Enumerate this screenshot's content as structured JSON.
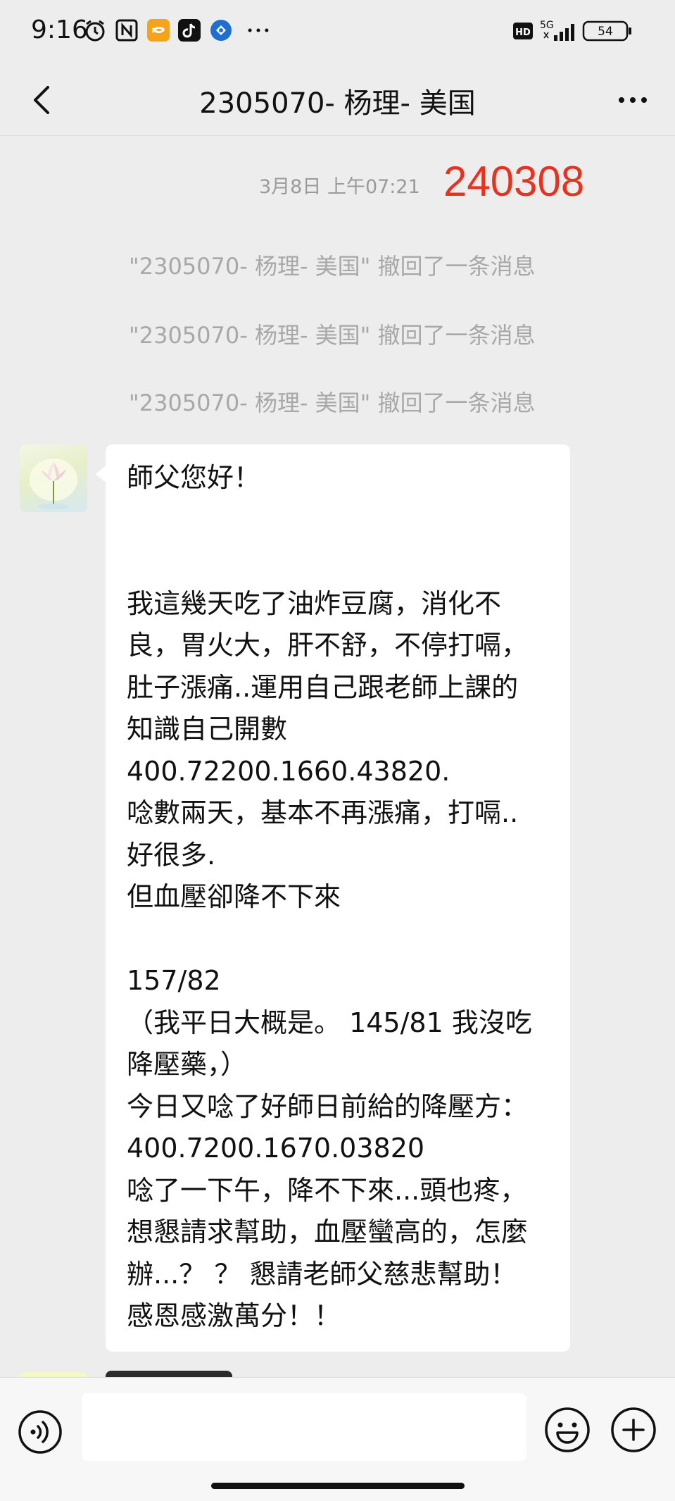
{
  "status_bar": {
    "time": "9:16",
    "icons": [
      "alarm-icon",
      "nfc-icon",
      "app-icon-orange",
      "tiktok-icon",
      "app-icon-blue",
      "more-dots-icon"
    ],
    "network": "5G",
    "hd": "HD",
    "battery": "54"
  },
  "header": {
    "title": "2305070- 杨理- 美国",
    "back_icon": "chevron-left-icon",
    "more_icon": "more-horizontal-icon"
  },
  "chat": {
    "timestamp": "3月8日 上午07:21",
    "annotation": "240308",
    "system_messages": [
      "\"2305070- 杨理- 美国\" 撤回了一条消息",
      "\"2305070- 杨理- 美国\" 撤回了一条消息",
      "\"2305070- 杨理- 美国\" 撤回了一条消息"
    ],
    "message": {
      "lines": [
        "師父您好！",
        "",
        "",
        "我這幾天吃了油炸豆腐，消化不",
        "良，胃火大，肝不舒，不停打嗝，",
        "肚子漲痛..運用自己跟老師上課的",
        "知識自己開數",
        "400.72200.1660.43820.",
        "唸數兩天，基本不再漲痛，打嗝..",
        "好很多.",
        "但血壓卻降不下來",
        "",
        "157/82",
        "（我平日大概是。 145/81 我沒吃",
        "降壓藥，）",
        "今日又唸了好師日前給的降壓方：",
        "400.7200.1670.03820",
        "唸了一下午，降不下來...頭也疼，",
        "想懇請求幫助，血壓蠻高的，怎麼",
        "辦...？ ？ 懇請老師父慈悲幫助！",
        "感恩感激萬分！！"
      ]
    }
  },
  "input_bar": {
    "voice_icon": "voice-icon",
    "emoji_icon": "emoji-icon",
    "plus_icon": "plus-circle-icon"
  },
  "colors": {
    "background": "#ededed",
    "bubble": "#ffffff",
    "annotation": "#e8321e",
    "system_text": "#a8a8a8"
  }
}
